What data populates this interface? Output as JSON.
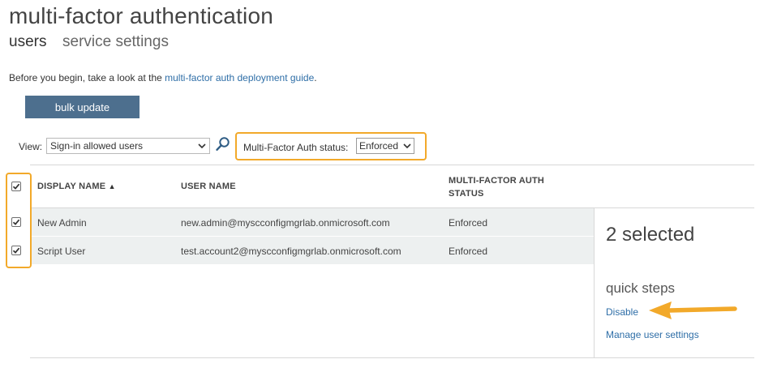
{
  "page": {
    "title": "multi-factor authentication",
    "tabs": [
      {
        "label": "users",
        "active": true
      },
      {
        "label": "service settings",
        "active": false
      }
    ],
    "intro_prefix": "Before you begin, take a look at the ",
    "intro_link": "multi-factor auth deployment guide",
    "intro_suffix": "."
  },
  "toolbar": {
    "bulk_update_label": "bulk update",
    "view_label": "View:",
    "view_selected": "Sign-in allowed users",
    "mfa_status_label": "Multi-Factor Auth status:",
    "mfa_status_selected": "Enforced",
    "search_icon": "search-icon"
  },
  "table": {
    "columns": [
      {
        "label": "DISPLAY NAME",
        "sorted": "ascending"
      },
      {
        "label": "USER NAME"
      },
      {
        "label": "MULTI-FACTOR AUTH\nSTATUS"
      }
    ],
    "sort_indicator": "▲",
    "header_checked": true,
    "rows": [
      {
        "display_name": "New Admin",
        "user_name": "new.admin@myscconfigmgrlab.onmicrosoft.com",
        "status": "Enforced",
        "checked": true
      },
      {
        "display_name": "Script User",
        "user_name": "test.account2@myscconfigmgrlab.onmicrosoft.com",
        "status": "Enforced",
        "checked": true
      }
    ]
  },
  "side_panel": {
    "selected_text": "2 selected",
    "quick_steps_title": "quick steps",
    "links": [
      "Disable",
      "Manage user settings"
    ]
  },
  "colors": {
    "highlight": "#f2a92a",
    "button_bg": "#4d6f8e",
    "link": "#2e6ea7",
    "row_bg": "#edf0f0"
  }
}
